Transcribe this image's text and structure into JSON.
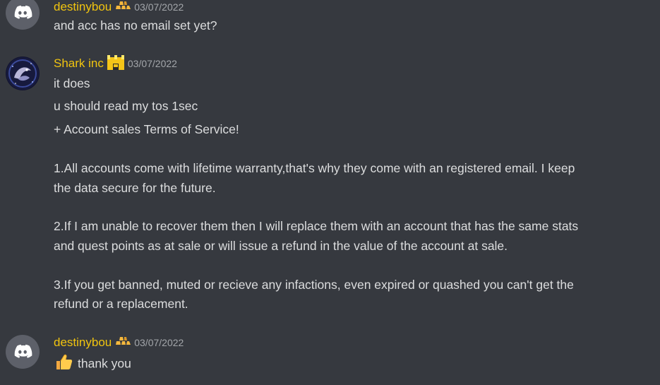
{
  "messages": [
    {
      "username": "destinybou",
      "badge": "gold-bars-icon",
      "timestamp": "03/07/2022",
      "avatar": "discord-logo-icon",
      "lines": [
        "and acc has no email set yet?"
      ]
    },
    {
      "username": "Shark inc",
      "badge": "castle-icon",
      "timestamp": "03/07/2022",
      "avatar": "shark-avatar",
      "lines": [
        "it does",
        "u should read my tos 1sec",
        "+ Account sales Terms of Service!",
        "1.All accounts come with lifetime warranty,that's why they come with an registered email. I keep",
        "the data secure for the future.",
        "2.If I am unable to recover them then I will replace them with an account that has the same stats",
        "and quest points as at sale or will issue a refund in the value of the account at sale.",
        "3.If you get banned, muted or recieve any infactions, even expired or quashed you can't get the",
        "refund or a replacement."
      ]
    },
    {
      "username": "destinybou",
      "badge": "gold-bars-icon",
      "timestamp": "03/07/2022",
      "avatar": "discord-logo-icon",
      "emoji": "thumbs-up-icon",
      "lines": [
        "thank you"
      ]
    }
  ],
  "colors": {
    "background": "#36393f",
    "username": "#f1c40f",
    "text": "#dcddde",
    "timestamp": "#a3a6aa",
    "discord_avatar_bg": "#5d6069"
  }
}
